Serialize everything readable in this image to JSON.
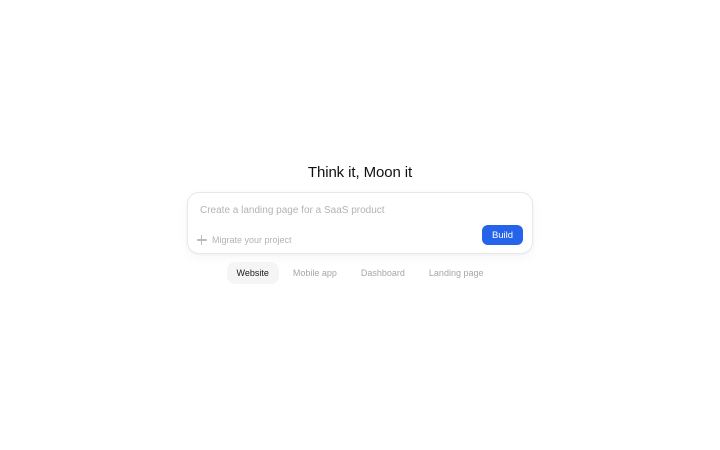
{
  "headline": "Think it, Moon it",
  "prompt": {
    "placeholder": "Create a landing page for a SaaS product",
    "value": "",
    "migrate_label": "Migrate your project",
    "build_label": "Build"
  },
  "tabs": [
    {
      "label": "Website",
      "active": true
    },
    {
      "label": "Mobile app",
      "active": false
    },
    {
      "label": "Dashboard",
      "active": false
    },
    {
      "label": "Landing page",
      "active": false
    }
  ],
  "colors": {
    "accent": "#2563eb",
    "background": "#ffffff"
  }
}
